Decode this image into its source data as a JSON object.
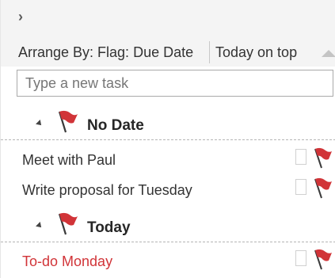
{
  "todo_bar": {
    "collapse_glyph": "›",
    "arrange_by_label": "Arrange By: Flag: Due Date",
    "order_label": "Today on top",
    "new_task_placeholder": "Type a new task"
  },
  "groups": [
    {
      "title": "No Date",
      "tasks": [
        {
          "subject": "Meet with Paul",
          "overdue": false
        },
        {
          "subject": "Write proposal for Tuesday",
          "overdue": false
        }
      ]
    },
    {
      "title": "Today",
      "tasks": [
        {
          "subject": "To-do Monday",
          "overdue": true
        }
      ]
    }
  ],
  "colors": {
    "flag_red": "#d13438",
    "overdue_text": "#d13438",
    "header_bg": "#f4f4f4"
  },
  "icons": {
    "collapse": "chevron-right-icon",
    "sort": "sort-ascending-icon",
    "group_expand": "collapse-triangle-icon",
    "flag": "red-flag-icon"
  }
}
